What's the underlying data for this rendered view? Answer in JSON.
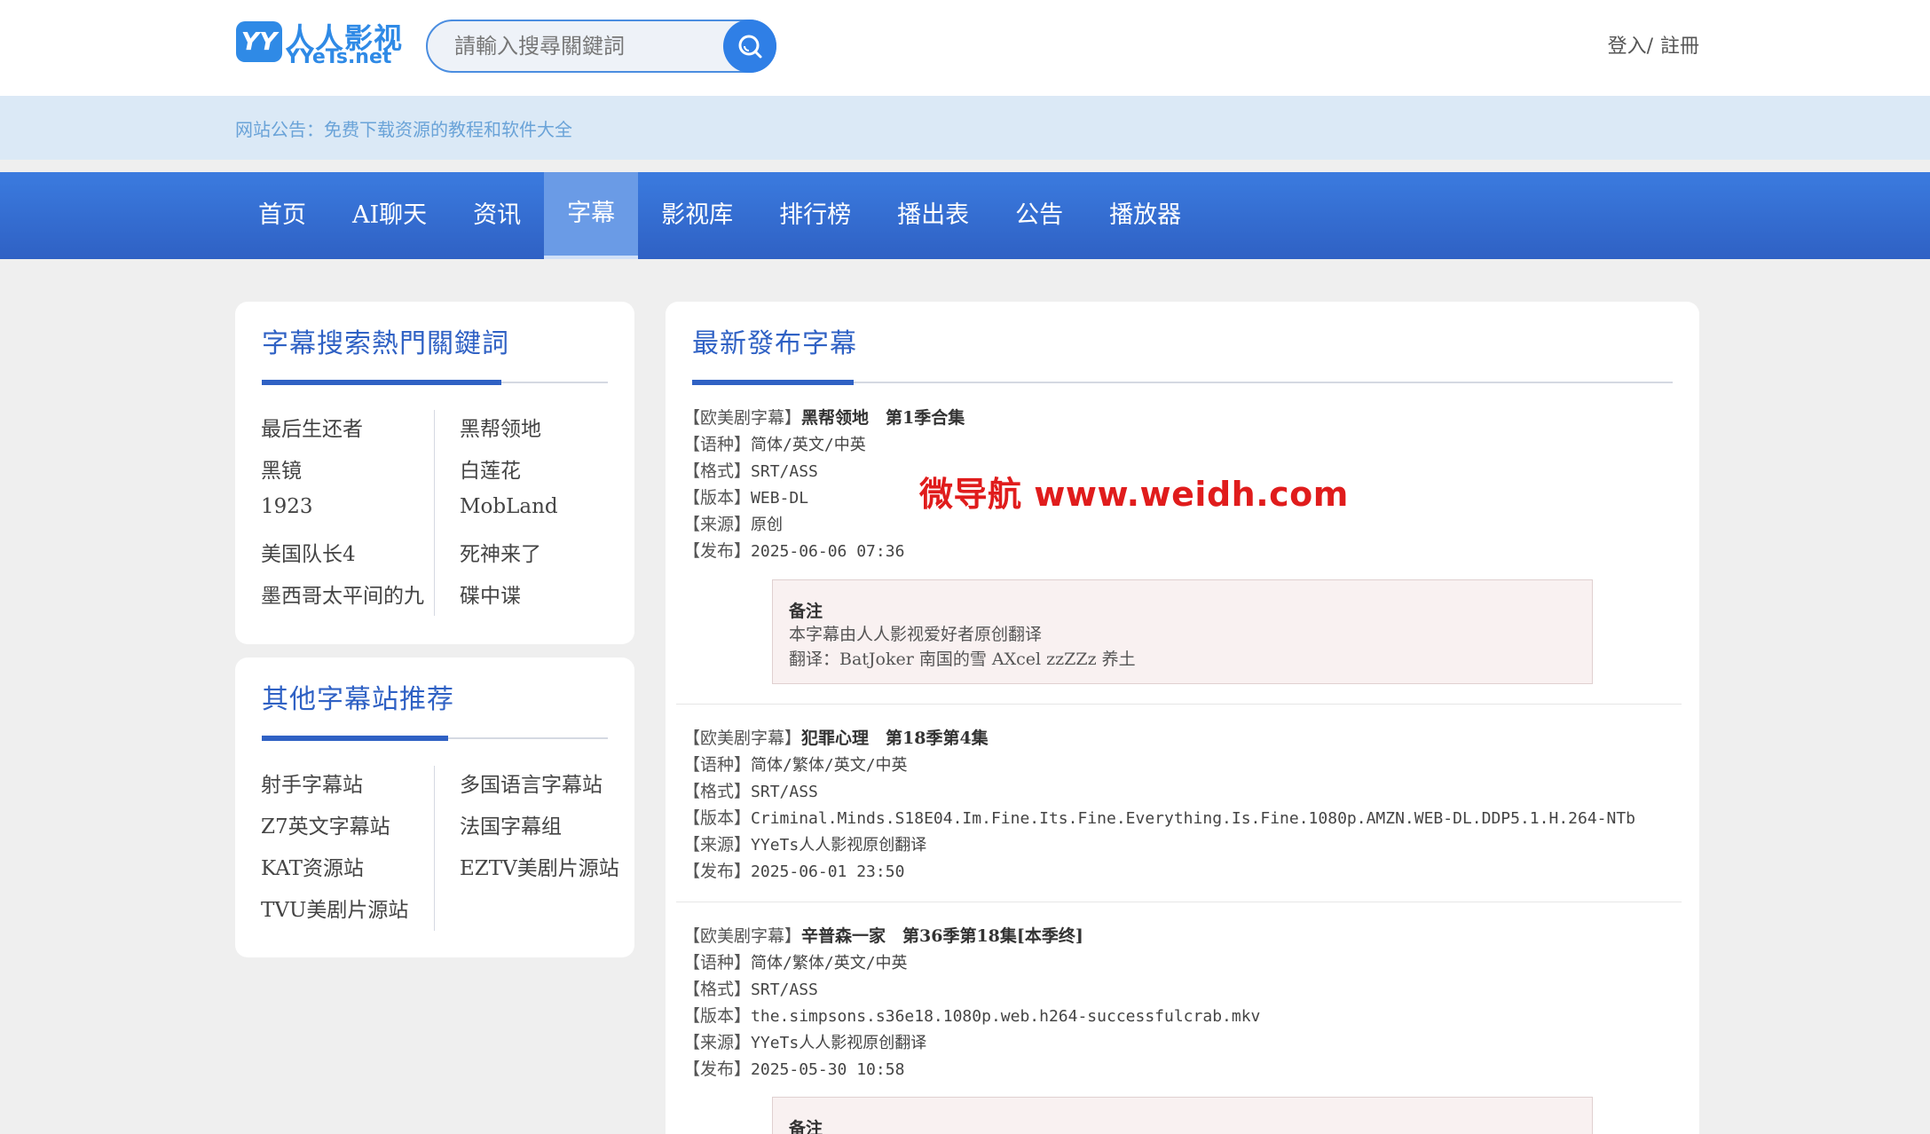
{
  "header": {
    "logo_cn": "人人影视",
    "logo_en": "YYeTs.net",
    "search_placeholder": "請輸入搜尋關鍵詞",
    "login": "登入/",
    "register": "註冊"
  },
  "notice": "网站公告：免费下载资源的教程和软件大全",
  "nav": [
    "首页",
    "AI聊天",
    "资讯",
    "字幕",
    "影视库",
    "排行榜",
    "播出表",
    "公告",
    "播放器"
  ],
  "nav_active": "字幕",
  "hot_keywords": {
    "title": "字幕搜索熱門關鍵詞",
    "left": [
      "最后生还者",
      "黑镜",
      "1923",
      "美国队长4",
      "墨西哥太平间的九"
    ],
    "right": [
      "黑帮领地",
      "白莲花",
      "MobLand",
      "死神来了",
      "碟中谍"
    ]
  },
  "other_sites": {
    "title": "其他字幕站推荐",
    "left": [
      "射手字幕站",
      "Z7英文字幕站",
      "KAT资源站",
      "TVU美剧片源站"
    ],
    "right": [
      "多国语言字幕站",
      "法国字幕组",
      "EZTV美剧片源站"
    ]
  },
  "latest": {
    "title": "最新發布字幕",
    "entries": [
      {
        "category": "【欧美剧字幕】",
        "name": "黑帮领地　第1季合集",
        "lang_label": "【语种】",
        "lang": "简体/英文/中英",
        "format_label": "【格式】",
        "format": "SRT/ASS",
        "version_label": "【版本】",
        "version": "WEB-DL",
        "source_label": "【来源】",
        "source": "原创",
        "date_label": "【发布】",
        "date": "2025-06-06 07:36",
        "note_title": "备注",
        "note_line1": "本字幕由人人影视爱好者原创翻译",
        "note_line2": "翻译：BatJoker 南国的雪 AXcel zzZZz 养土"
      },
      {
        "category": "【欧美剧字幕】",
        "name": "犯罪心理　第18季第4集",
        "lang_label": "【语种】",
        "lang": "简体/繁体/英文/中英",
        "format_label": "【格式】",
        "format": "SRT/ASS",
        "version_label": "【版本】",
        "version": "Criminal.Minds.S18E04.Im.Fine.Its.Fine.Everything.Is.Fine.1080p.AMZN.WEB-DL.DDP5.1.H.264-NTb",
        "source_label": "【来源】",
        "source": "YYeTs人人影视原创翻译",
        "date_label": "【发布】",
        "date": "2025-06-01 23:50"
      },
      {
        "category": "【欧美剧字幕】",
        "name": "辛普森一家　第36季第18集[本季终]",
        "lang_label": "【语种】",
        "lang": "简体/繁体/英文/中英",
        "format_label": "【格式】",
        "format": "SRT/ASS",
        "version_label": "【版本】",
        "version": "the.simpsons.s36e18.1080p.web.h264-successfulcrab.mkv",
        "source_label": "【来源】",
        "source": "YYeTs人人影视原创翻译",
        "date_label": "【发布】",
        "date": "2025-05-30 10:58",
        "note_title": "备注"
      }
    ]
  },
  "watermark": "微导航 www.weidh.com",
  "colors": {
    "accent": "#2f61c4",
    "nav_bg": "#3b7bdf",
    "notice_bg": "#dbe9f6",
    "watermark": "#e01c1c"
  }
}
